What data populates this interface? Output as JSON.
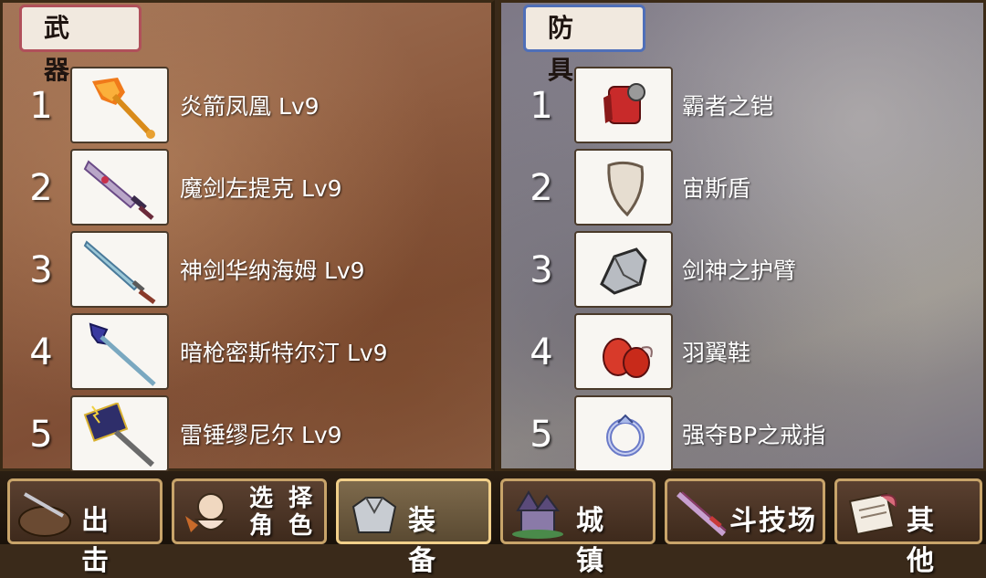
{
  "weapons": {
    "tab_label": "武 器",
    "items": [
      {
        "num": "1",
        "name": "炎箭凤凰 Lv9",
        "icon": "flame-bow-icon"
      },
      {
        "num": "2",
        "name": "魔剑左提克 Lv9",
        "icon": "demon-sword-icon"
      },
      {
        "num": "3",
        "name": "神剑华纳海姆 Lv9",
        "icon": "holy-sword-icon"
      },
      {
        "num": "4",
        "name": "暗枪密斯特尔汀 Lv9",
        "icon": "dark-spear-icon"
      },
      {
        "num": "5",
        "name": "雷锤缪尼尔 Lv9",
        "icon": "thunder-hammer-icon"
      }
    ]
  },
  "armor": {
    "tab_label": "防 具",
    "items": [
      {
        "num": "1",
        "name": "霸者之铠",
        "icon": "armor-icon"
      },
      {
        "num": "2",
        "name": "宙斯盾",
        "icon": "shield-icon"
      },
      {
        "num": "3",
        "name": "剑神之护臂",
        "icon": "gauntlet-icon"
      },
      {
        "num": "4",
        "name": "羽翼鞋",
        "icon": "winged-boots-icon"
      },
      {
        "num": "5",
        "name": "强夺BP之戒指",
        "icon": "ring-icon"
      }
    ]
  },
  "nav": {
    "sortie": "出 击",
    "select_line1": "选 择",
    "select_line2": "角 色",
    "equip": "装 备",
    "town": "城 镇",
    "arena": "斗技场",
    "other": "其 他"
  },
  "colors": {
    "weapon_tab_border": "#b0505a",
    "armor_tab_border": "#4f6fb8",
    "nav_border": "#c8a46a"
  }
}
